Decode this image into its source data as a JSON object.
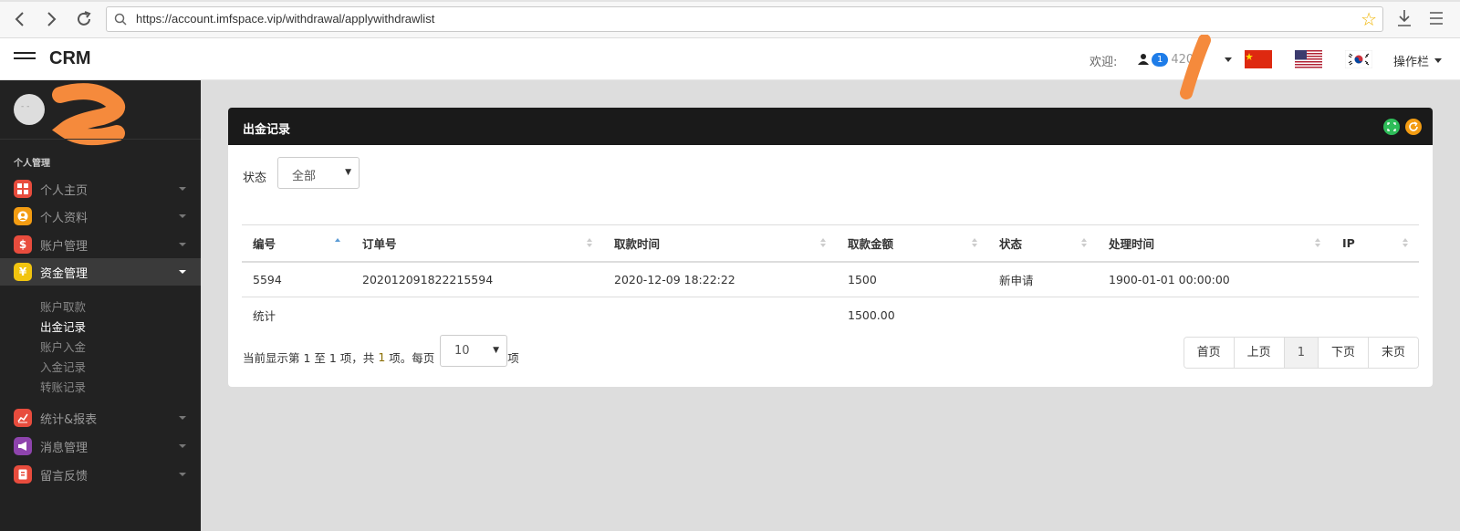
{
  "browser": {
    "url": "https://account.imfspace.vip/withdrawal/applywithdrawlist"
  },
  "header": {
    "brand": "CRM",
    "welcome": "欢迎:",
    "user_badge": "1",
    "user_name": "420",
    "op_menu": "操作栏"
  },
  "sidebar": {
    "section": "个人管理",
    "items": [
      {
        "label": "个人主页",
        "icon": "grid-icon",
        "color": "#e84c3d"
      },
      {
        "label": "个人资料",
        "icon": "user-circle-icon",
        "color": "#f39c12"
      },
      {
        "label": "账户管理",
        "icon": "dollar-icon",
        "color": "#e84c3d"
      },
      {
        "label": "资金管理",
        "icon": "yen-icon",
        "color": "#f1c40f"
      },
      {
        "label": "统计&报表",
        "icon": "chart-icon",
        "color": "#e84c3d"
      },
      {
        "label": "消息管理",
        "icon": "megaphone-icon",
        "color": "#8e44ad"
      },
      {
        "label": "留言反馈",
        "icon": "note-icon",
        "color": "#e84c3d"
      }
    ],
    "sub_items": [
      "账户取款",
      "出金记录",
      "账户入金",
      "入金记录",
      "转账记录"
    ]
  },
  "panel": {
    "title": "出金记录",
    "filter_label": "状态",
    "filter_value": "全部",
    "columns": [
      "编号",
      "订单号",
      "取款时间",
      "取款金额",
      "状态",
      "处理时间",
      "IP"
    ],
    "rows": [
      [
        "5594",
        "202012091822215594",
        "2020-12-09 18:22:22",
        "1500",
        "新申请",
        "1900-01-01 00:00:00",
        ""
      ]
    ],
    "summary_label": "统计",
    "summary_amount": "1500.00",
    "pager_text_1": "当前显示第 1 至 1 项，共",
    "pager_total": "1",
    "pager_text_2": "项。每页",
    "page_size": "10",
    "pager_text_3": "项",
    "pager_buttons": [
      "首页",
      "上页",
      "1",
      "下页",
      "末页"
    ]
  },
  "colors": {
    "sidebar_bg": "#222222",
    "panel_header_bg": "#1a1a1a",
    "badge": "#1e7ce8",
    "amount_green": "#3c8d3c"
  }
}
